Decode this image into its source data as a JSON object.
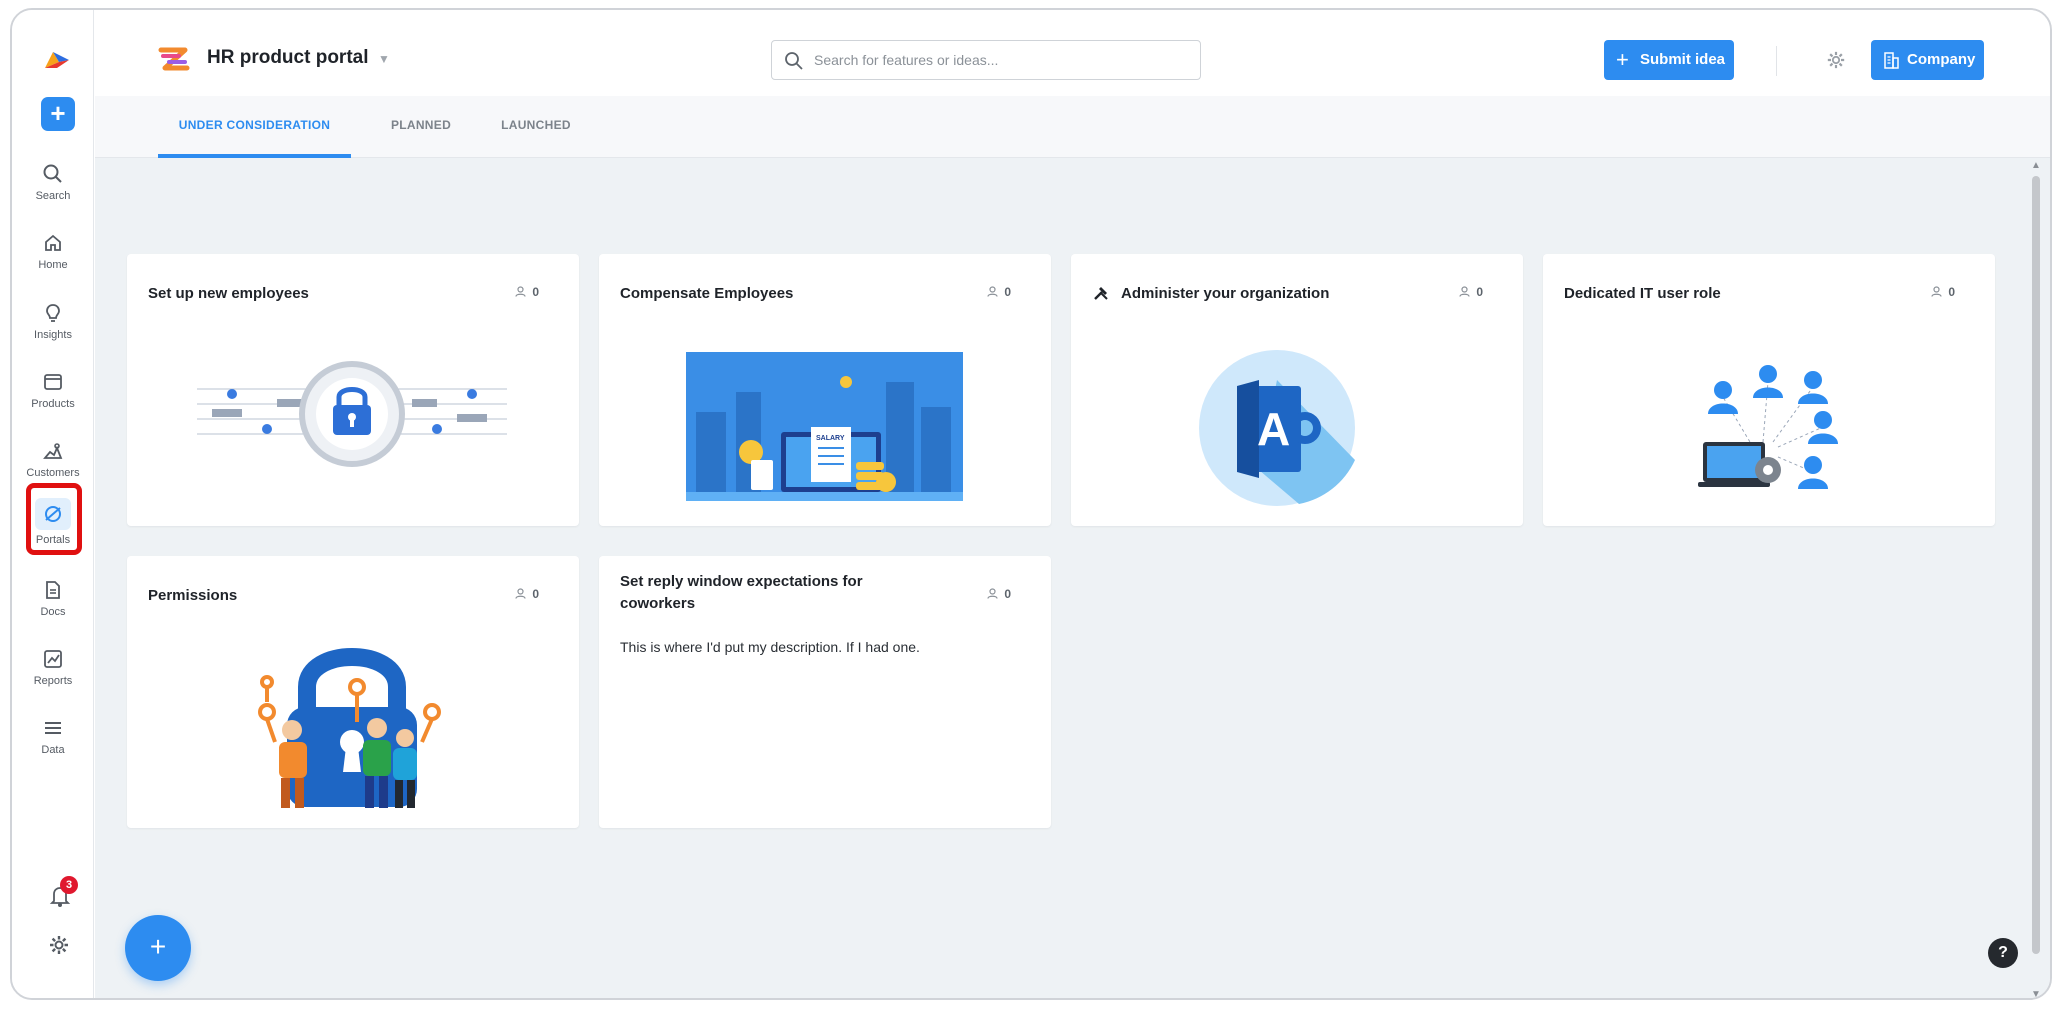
{
  "header": {
    "portal_title": "HR product portal",
    "search_placeholder": "Search for features or ideas...",
    "submit_label": "Submit idea",
    "company_label": "Company"
  },
  "rail": {
    "items": [
      {
        "label": "Search",
        "icon": "search-icon"
      },
      {
        "label": "Home",
        "icon": "home-icon"
      },
      {
        "label": "Insights",
        "icon": "lightbulb-icon"
      },
      {
        "label": "Products",
        "icon": "window-icon"
      },
      {
        "label": "Customers",
        "icon": "customers-icon"
      },
      {
        "label": "Portals",
        "icon": "portal-icon"
      },
      {
        "label": "Docs",
        "icon": "doc-icon"
      },
      {
        "label": "Reports",
        "icon": "chart-icon"
      },
      {
        "label": "Data",
        "icon": "menu-icon"
      }
    ],
    "active": "Portals",
    "notification_count": "3"
  },
  "tabs": [
    {
      "label": "UNDER CONSIDERATION",
      "active": true
    },
    {
      "label": "PLANNED",
      "active": false
    },
    {
      "label": "LAUNCHED",
      "active": false
    }
  ],
  "cards": [
    {
      "title": "Set up new employees",
      "votes": "0",
      "art": "padlock-circuit-illustration"
    },
    {
      "title": "Compensate Employees",
      "votes": "0",
      "art": "salary-illustration"
    },
    {
      "title": "Administer your organization",
      "votes": "0",
      "title_icon": "tools-icon",
      "art": "access-app-icon"
    },
    {
      "title": "Dedicated IT user role",
      "votes": "0",
      "art": "network-users-illustration"
    },
    {
      "title": "Permissions",
      "votes": "0",
      "art": "keys-lock-illustration"
    },
    {
      "title": "Set reply window expectations for coworkers",
      "votes": "0",
      "description": "This is where I'd put my description. If I had one."
    }
  ],
  "help_label": "?",
  "fab_label": "+",
  "colors": {
    "accent": "#2d8cf0",
    "background": "#eef2f5",
    "highlight": "#e01010"
  }
}
